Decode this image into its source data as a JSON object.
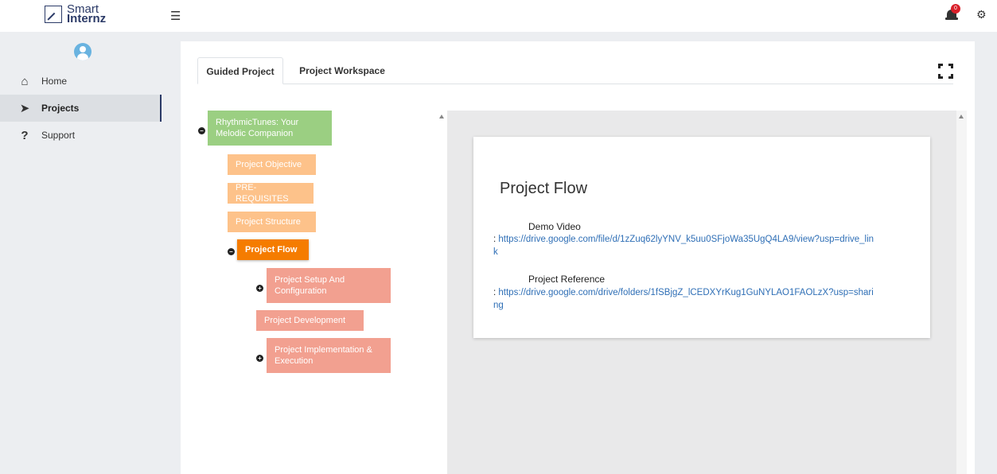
{
  "brand": {
    "line1": "Smart",
    "line2": "Internz"
  },
  "header": {
    "menu_icon": "hamburger-icon",
    "notifications_count": "0",
    "settings_icon": "gear-icon"
  },
  "sidebar": {
    "items": [
      {
        "label": "Home",
        "icon": "home-icon"
      },
      {
        "label": "Projects",
        "icon": "paper-plane-icon",
        "active": true
      },
      {
        "label": "Support",
        "icon": "question-icon"
      }
    ]
  },
  "tabs": [
    {
      "label": "Guided Project",
      "active": true
    },
    {
      "label": "Project Workspace",
      "active": false
    }
  ],
  "tree": {
    "root": "RhythmicTunes: Your Melodic Companion",
    "sections": [
      "Project Objective",
      "PRE-REQUISITES",
      "Project Structure"
    ],
    "active": "Project Flow",
    "children": [
      "Project Setup And Configuration",
      "Project Development",
      "Project Implementation & Execution"
    ]
  },
  "content": {
    "title": "Project Flow",
    "demo_label": "Demo Video",
    "demo_link": "https://drive.google.com/file/d/1zZuq62lyYNV_k5uu0SFjoWa35UgQ4LA9/view?usp=drive_link",
    "ref_label": "Project Reference",
    "ref_link": "https://drive.google.com/drive/folders/1fSBjgZ_lCEDXYrKug1GuNYLAO1FAOLzX?usp=sharing"
  },
  "colors": {
    "brand": "#2b3a67",
    "root_node": "#9bcf82",
    "section_node": "#fdc28a",
    "active_node": "#f57c00",
    "child_node": "#f2a090",
    "link": "#2f6fb6"
  }
}
